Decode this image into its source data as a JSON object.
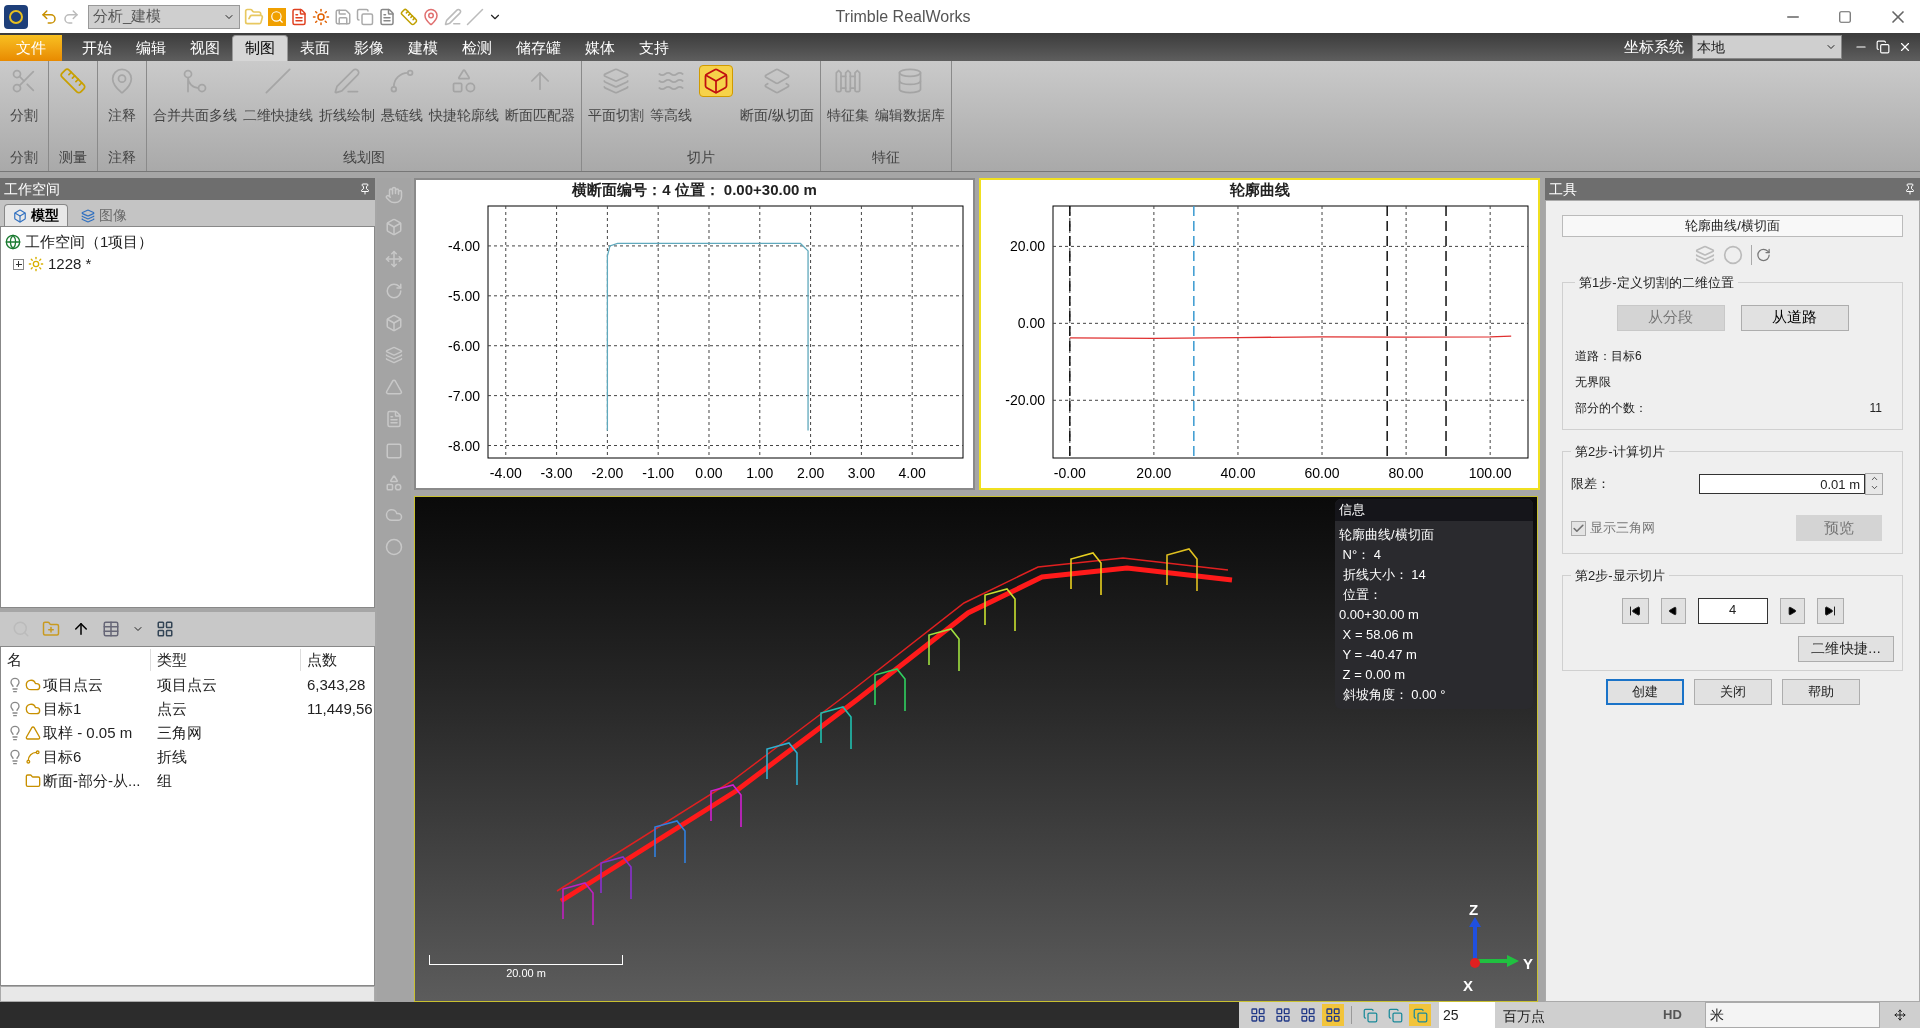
{
  "title_bar": {
    "mode_combo": "分析_建模",
    "app_title": "Trimble RealWorks"
  },
  "ribbon_tabs": [
    {
      "label": "文件",
      "kind": "file",
      "selected": false
    },
    {
      "label": "开始",
      "kind": "tab",
      "selected": false
    },
    {
      "label": "编辑",
      "kind": "tab",
      "selected": false
    },
    {
      "label": "视图",
      "kind": "tab",
      "selected": false
    },
    {
      "label": "制图",
      "kind": "tab",
      "selected": true
    },
    {
      "label": "表面",
      "kind": "tab",
      "selected": false
    },
    {
      "label": "影像",
      "kind": "tab",
      "selected": false
    },
    {
      "label": "建模",
      "kind": "tab",
      "selected": false
    },
    {
      "label": "检测",
      "kind": "tab",
      "selected": false
    },
    {
      "label": "储存罐",
      "kind": "tab",
      "selected": false
    },
    {
      "label": "媒体",
      "kind": "tab",
      "selected": false
    },
    {
      "label": "支持",
      "kind": "tab",
      "selected": false
    }
  ],
  "coordinate_system": {
    "label": "坐标系统",
    "value": "本地"
  },
  "ribbon_groups": [
    {
      "title": "分割",
      "tools": [
        {
          "label": "分割",
          "disabled": true,
          "selected": false
        }
      ]
    },
    {
      "title": "测量",
      "tools": [
        {
          "disabled": false,
          "selected": false
        }
      ]
    },
    {
      "title": "注释",
      "tools": [
        {
          "label": "注释",
          "disabled": true,
          "selected": false
        }
      ]
    },
    {
      "title": "线划图",
      "tools": [
        {
          "label": "合并共面多线",
          "disabled": true,
          "selected": false
        },
        {
          "label": "二维快捷线",
          "disabled": true,
          "selected": false
        },
        {
          "label": "折线绘制",
          "disabled": true,
          "selected": false
        },
        {
          "label": "悬链线",
          "disabled": true,
          "selected": false
        },
        {
          "label": "快捷轮廓线",
          "disabled": true,
          "selected": false
        },
        {
          "label": "断面匹配器",
          "disabled": true,
          "selected": false
        }
      ]
    },
    {
      "title": "切片",
      "tools": [
        {
          "label": "平面切割",
          "disabled": true,
          "selected": false
        },
        {
          "label": "等高线",
          "disabled": true,
          "selected": false
        },
        {
          "disabled": false,
          "selected": true
        },
        {
          "label": "断面/纵切面",
          "disabled": true,
          "selected": false
        }
      ]
    },
    {
      "title": "特征",
      "tools": [
        {
          "label": "特征集",
          "disabled": true,
          "selected": false
        },
        {
          "label": "编辑数据库",
          "disabled": true,
          "selected": false
        }
      ]
    }
  ],
  "workspace": {
    "title": "工作空间",
    "tabs": [
      {
        "label": "模型",
        "selected": true
      },
      {
        "label": "图像",
        "selected": false
      }
    ],
    "tree": [
      {
        "label": "工作空间（1项目）",
        "children": [
          {
            "label": "1228 *",
            "expanded": false
          }
        ]
      }
    ],
    "list": {
      "columns": [
        "名",
        "类型",
        "点数"
      ],
      "rows": [
        {
          "name": "项目点云",
          "type": "项目点云",
          "points": "6,343,28",
          "light": true
        },
        {
          "name": "目标1",
          "type": "点云",
          "points": "11,449,56",
          "light": true
        },
        {
          "name": "取样 - 0.05 m",
          "type": "三角网",
          "light": true
        },
        {
          "name": "目标6",
          "type": "折线",
          "light": true
        },
        {
          "name": "断面-部分-从...",
          "type": "组",
          "light": false
        }
      ]
    }
  },
  "cross_section": {
    "active": false,
    "chart_data": {
      "type": "line",
      "title": "横断面编号：4  位置：  0.00+30.00 m",
      "x": [
        -2,
        -2,
        -1.95,
        -1.8,
        1.8,
        1.95,
        1.95
      ],
      "grid": true,
      "series": [
        {
          "color": "#5fa9bd",
          "values": [
            -7.7,
            -4.2,
            -4.0,
            -3.95,
            -3.95,
            -4.1,
            -7.7
          ]
        }
      ],
      "xlim": [
        -4.35,
        5
      ],
      "ylim": [
        -8.25,
        -3.2
      ],
      "xticks": [
        {
          "value": -4,
          "label": "-4.00"
        },
        {
          "value": -3,
          "label": "-3.00"
        },
        {
          "value": -2,
          "label": "-2.00"
        },
        {
          "value": -1,
          "label": "-1.00"
        },
        {
          "value": 0,
          "label": "0.00"
        },
        {
          "value": 1,
          "label": "1.00"
        },
        {
          "value": 2,
          "label": "2.00"
        },
        {
          "value": 3,
          "label": "3.00"
        },
        {
          "value": 4,
          "label": "4.00"
        }
      ],
      "yticks": [
        {
          "value": -4,
          "label": "-4.00"
        },
        {
          "value": -5,
          "label": "-5.00"
        },
        {
          "value": -6,
          "label": "-6.00"
        },
        {
          "value": -7,
          "label": "-7.00"
        },
        {
          "value": -8,
          "label": "-8.00"
        }
      ]
    }
  },
  "profile": {
    "active": true,
    "chart_data": {
      "type": "line",
      "title": "轮廓曲线",
      "x": [
        0,
        20,
        40,
        60,
        80,
        100,
        105
      ],
      "grid": true,
      "series": [
        {
          "color": "#e03030",
          "values": [
            -3.8,
            -3.9,
            -3.7,
            -3.5,
            -3.6,
            -3.5,
            -3.3
          ]
        }
      ],
      "xlim": [
        -4,
        109
      ],
      "ylim": [
        -35,
        30.5
      ],
      "xticks": [
        {
          "value": 0,
          "label": "-0.00"
        },
        {
          "value": 20,
          "label": "20.00"
        },
        {
          "value": 40,
          "label": "40.00"
        },
        {
          "value": 60,
          "label": "60.00"
        },
        {
          "value": 80,
          "label": "80.00"
        },
        {
          "value": 100,
          "label": "100.00"
        }
      ],
      "yticks": [
        {
          "value": 20,
          "label": "20.00"
        },
        {
          "value": 0,
          "label": "0.00"
        },
        {
          "value": -20,
          "label": "-20.00"
        }
      ],
      "ref_lines": [
        {
          "axis": "x",
          "value": 0,
          "color": "#111111"
        },
        {
          "axis": "x",
          "value": 29.5,
          "color": "#3a9ad0"
        },
        {
          "axis": "x",
          "value": 75.5,
          "color": "#111111"
        },
        {
          "axis": "x",
          "value": 89.5,
          "color": "#111111"
        }
      ]
    }
  },
  "viewer": {
    "scale_bar": "20.00 m",
    "axes": [
      "Z",
      "Y",
      "X"
    ],
    "info": {
      "title": "信息",
      "lines": [
        "轮廓曲线/横切面",
        " N°： 4",
        " 折线大小： 14",
        " 位置：",
        "0.00+30.00 m",
        " X = 58.06 m",
        " Y = -40.47 m",
        " Z = 0.00 m",
        " 斜坡角度： 0.00 °"
      ]
    }
  },
  "tools_panel": {
    "title": "工具",
    "tool_title": "轮廓曲线/横切面",
    "step1": {
      "legend": "第1步-定义切割的二维位置",
      "buttons": [
        {
          "label": "从分段",
          "disabled": true
        },
        {
          "label": "从道路",
          "disabled": false
        }
      ],
      "road": "道路：目标6",
      "bounds": "无界限",
      "count_label": "部分的个数：",
      "count": "11"
    },
    "step2": {
      "legend": "第2步-计算切片",
      "tolerance_label": "限差：",
      "tolerance": "0.01 m",
      "show_mesh": {
        "label": "显示三角网",
        "checked": true,
        "disabled": true
      },
      "preview": {
        "label": "预览",
        "disabled": true
      }
    },
    "step3": {
      "legend": "第2步-显示切片",
      "slice": "4",
      "quick": "二维快捷..."
    },
    "buttons": [
      {
        "label": "创建",
        "focused": true
      },
      {
        "label": "关闭",
        "focused": false
      },
      {
        "label": "帮助",
        "focused": false
      }
    ]
  },
  "status_bar": {
    "layouts": [
      {
        "selected": false
      },
      {
        "selected": false
      },
      {
        "selected": false
      },
      {
        "selected": true
      }
    ],
    "cloud_modes": [
      {
        "selected": false
      },
      {
        "selected": false
      },
      {
        "selected": true
      }
    ],
    "point_budget": "25",
    "unit_label": "百万点",
    "quality": "HD",
    "length_unit": "米"
  }
}
